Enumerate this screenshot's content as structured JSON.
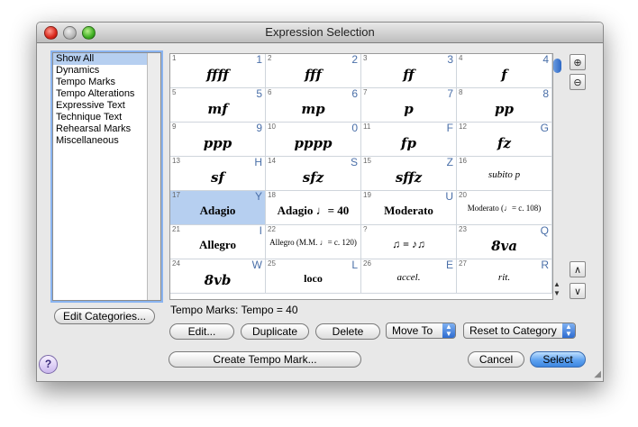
{
  "window": {
    "title": "Expression Selection"
  },
  "categories": {
    "items": [
      {
        "label": "Show All",
        "selected": true
      },
      {
        "label": "Dynamics"
      },
      {
        "label": "Tempo Marks"
      },
      {
        "label": "Tempo Alterations"
      },
      {
        "label": "Expressive Text"
      },
      {
        "label": "Technique Text"
      },
      {
        "label": "Rehearsal Marks"
      },
      {
        "label": "Miscellaneous"
      }
    ],
    "edit_button": "Edit Categories..."
  },
  "grid": {
    "cells": [
      {
        "num": "1",
        "key": "1",
        "text": "ffff",
        "style": "dyn"
      },
      {
        "num": "2",
        "key": "2",
        "text": "fff",
        "style": "dyn"
      },
      {
        "num": "3",
        "key": "3",
        "text": "ff",
        "style": "dyn"
      },
      {
        "num": "4",
        "key": "4",
        "text": "f",
        "style": "dyn"
      },
      {
        "num": "5",
        "key": "5",
        "text": "mf",
        "style": "dyn"
      },
      {
        "num": "6",
        "key": "6",
        "text": "mp",
        "style": "dyn"
      },
      {
        "num": "7",
        "key": "7",
        "text": "p",
        "style": "dyn"
      },
      {
        "num": "8",
        "key": "8",
        "text": "pp",
        "style": "dyn"
      },
      {
        "num": "9",
        "key": "9",
        "text": "ppp",
        "style": "dyn"
      },
      {
        "num": "10",
        "key": "0",
        "text": "pppp",
        "style": "dyn"
      },
      {
        "num": "11",
        "key": "F",
        "text": "fp",
        "style": "dyn"
      },
      {
        "num": "12",
        "key": "G",
        "text": "fz",
        "style": "dyn"
      },
      {
        "num": "13",
        "key": "H",
        "text": "sf",
        "style": "dyn"
      },
      {
        "num": "14",
        "key": "S",
        "text": "sfz",
        "style": "dyn"
      },
      {
        "num": "15",
        "key": "Z",
        "text": "sffz",
        "style": "dyn"
      },
      {
        "num": "16",
        "key": "",
        "text": "subito p",
        "style": "it"
      },
      {
        "num": "17",
        "key": "Y",
        "text": "Adagio",
        "style": "txt",
        "selected": true
      },
      {
        "num": "18",
        "key": "",
        "text": "Adagio ♩= 40",
        "style": "txt"
      },
      {
        "num": "19",
        "key": "U",
        "text": "Moderato",
        "style": "txt"
      },
      {
        "num": "20",
        "key": "",
        "text": "Moderato (♩= c. 108)",
        "style": "small"
      },
      {
        "num": "21",
        "key": "I",
        "text": "Allegro",
        "style": "txt"
      },
      {
        "num": "22",
        "key": "",
        "text": "Allegro (M.M. ♩= c. 120)",
        "style": "small"
      },
      {
        "num": "?",
        "key": "",
        "text": "♫ = ♪♫",
        "style": "reg"
      },
      {
        "num": "23",
        "key": "Q",
        "text": "8va",
        "style": "dyn"
      },
      {
        "num": "24",
        "key": "W",
        "text": "8vb",
        "style": "dyn"
      },
      {
        "num": "25",
        "key": "L",
        "text": "loco",
        "style": "reg"
      },
      {
        "num": "26",
        "key": "E",
        "text": "accel.",
        "style": "it"
      },
      {
        "num": "27",
        "key": "R",
        "text": "rit.",
        "style": "it"
      }
    ]
  },
  "status": "Tempo Marks: Tempo = 40",
  "buttons": {
    "edit": "Edit...",
    "duplicate": "Duplicate",
    "delete": "Delete",
    "move_to": "Move To",
    "reset_to_category": "Reset to Category",
    "create_tempo_mark": "Create Tempo Mark...",
    "cancel": "Cancel",
    "select": "Select"
  },
  "colors": {
    "selection": "#b6cff0",
    "accent": "#3d86e0",
    "key_label": "#4a6fa8"
  },
  "icons": [
    "zoom-in-icon",
    "zoom-out-icon",
    "scroll-up-icon",
    "scroll-down-icon",
    "help-icon"
  ]
}
